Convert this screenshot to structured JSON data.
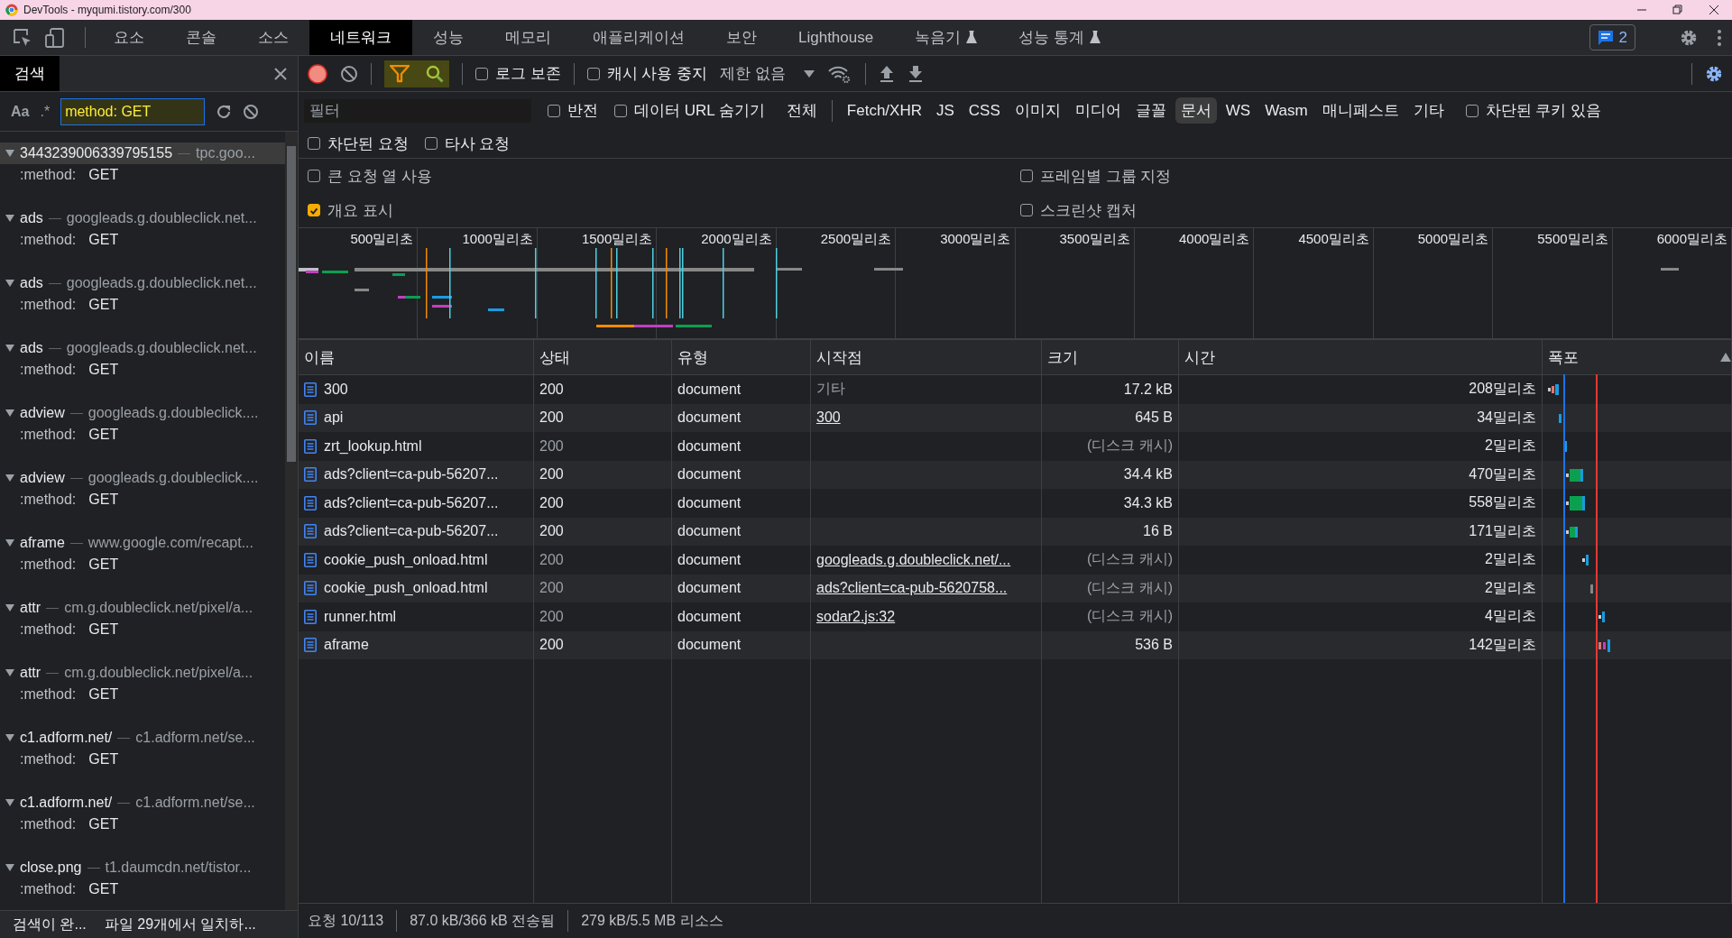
{
  "window": {
    "title": "DevTools - myqumi.tistory.com/300"
  },
  "tabs": [
    {
      "label": "요소",
      "selected": false,
      "experimental": false
    },
    {
      "label": "콘솔",
      "selected": false,
      "experimental": false
    },
    {
      "label": "소스",
      "selected": false,
      "experimental": false
    },
    {
      "label": "네트워크",
      "selected": true,
      "experimental": false
    },
    {
      "label": "성능",
      "selected": false,
      "experimental": false
    },
    {
      "label": "메모리",
      "selected": false,
      "experimental": false
    },
    {
      "label": "애플리케이션",
      "selected": false,
      "experimental": false
    },
    {
      "label": "보안",
      "selected": false,
      "experimental": false
    },
    {
      "label": "Lighthouse",
      "selected": false,
      "experimental": false
    },
    {
      "label": "녹음기",
      "selected": false,
      "experimental": true
    },
    {
      "label": "성능 통계",
      "selected": false,
      "experimental": true
    }
  ],
  "issues_badge": {
    "count": "2"
  },
  "search_panel": {
    "title": "검색",
    "case_toggle": "Aa",
    "regex_toggle": ".*",
    "query": "method: GET",
    "results": [
      {
        "name": "3443239006339795155",
        "url": "tpc.goo...",
        "selected": true,
        "expanded": true,
        "match_key": ":method:",
        "match_value": "GET"
      },
      {
        "name": "ads",
        "url": "googleads.g.doubleclick.net...",
        "selected": false,
        "expanded": true,
        "match_key": ":method:",
        "match_value": "GET"
      },
      {
        "name": "ads",
        "url": "googleads.g.doubleclick.net...",
        "selected": false,
        "expanded": true,
        "match_key": ":method:",
        "match_value": "GET"
      },
      {
        "name": "ads",
        "url": "googleads.g.doubleclick.net...",
        "selected": false,
        "expanded": true,
        "match_key": ":method:",
        "match_value": "GET"
      },
      {
        "name": "adview",
        "url": "googleads.g.doubleclick....",
        "selected": false,
        "expanded": true,
        "match_key": ":method:",
        "match_value": "GET"
      },
      {
        "name": "adview",
        "url": "googleads.g.doubleclick....",
        "selected": false,
        "expanded": true,
        "match_key": ":method:",
        "match_value": "GET"
      },
      {
        "name": "aframe",
        "url": "www.google.com/recapt...",
        "selected": false,
        "expanded": true,
        "match_key": ":method:",
        "match_value": "GET"
      },
      {
        "name": "attr",
        "url": "cm.g.doubleclick.net/pixel/a...",
        "selected": false,
        "expanded": true,
        "match_key": ":method:",
        "match_value": "GET"
      },
      {
        "name": "attr",
        "url": "cm.g.doubleclick.net/pixel/a...",
        "selected": false,
        "expanded": true,
        "match_key": ":method:",
        "match_value": "GET"
      },
      {
        "name": "c1.adform.net/",
        "url": "c1.adform.net/se...",
        "selected": false,
        "expanded": true,
        "match_key": ":method:",
        "match_value": "GET"
      },
      {
        "name": "c1.adform.net/",
        "url": "c1.adform.net/se...",
        "selected": false,
        "expanded": true,
        "match_key": ":method:",
        "match_value": "GET"
      },
      {
        "name": "close.png",
        "url": "t1.daumcdn.net/tistor...",
        "selected": false,
        "expanded": true,
        "match_key": ":method:",
        "match_value": "GET"
      }
    ],
    "status": [
      "검색이 완...",
      "파일 29개에서 일치하..."
    ]
  },
  "network": {
    "toolbar": {
      "recording": true,
      "filter_shown": true,
      "search_shown": true,
      "preserve_log": {
        "label": "로그 보존",
        "checked": false
      },
      "disable_cache": {
        "label": "캐시 사용 중지",
        "checked": false
      },
      "throttling": "제한 없음"
    },
    "filter": {
      "placeholder": "필터",
      "invert": {
        "label": "반전",
        "checked": false
      },
      "hide_data_urls": {
        "label": "데이터 URL 숨기기",
        "checked": false
      },
      "types": [
        {
          "label": "전체",
          "selected": false
        },
        {
          "label": "Fetch/XHR",
          "selected": false
        },
        {
          "label": "JS",
          "selected": false
        },
        {
          "label": "CSS",
          "selected": false
        },
        {
          "label": "이미지",
          "selected": false
        },
        {
          "label": "미디어",
          "selected": false
        },
        {
          "label": "글꼴",
          "selected": false
        },
        {
          "label": "문서",
          "selected": true
        },
        {
          "label": "WS",
          "selected": false
        },
        {
          "label": "Wasm",
          "selected": false
        },
        {
          "label": "매니페스트",
          "selected": false
        },
        {
          "label": "기타",
          "selected": false
        }
      ],
      "blocked_cookies": {
        "label": "차단된 쿠키 있음",
        "checked": false
      },
      "blocked_requests": {
        "label": "차단된 요청",
        "checked": false
      },
      "third_party": {
        "label": "타사 요청",
        "checked": false
      }
    },
    "settings": [
      {
        "label": "큰 요청 열 사용",
        "checked": false
      },
      {
        "label": "프레임별 그룹 지정",
        "checked": false
      },
      {
        "label": "개요 표시",
        "checked": true
      },
      {
        "label": "스크린샷 캡처",
        "checked": false
      }
    ],
    "overview": {
      "ticks": [
        "500밀리초",
        "1000밀리초",
        "1500밀리초",
        "2000밀리초",
        "2500밀리초",
        "3000밀리초",
        "3500밀리초",
        "4000밀리초",
        "4500밀리초",
        "5000밀리초",
        "5500밀리초",
        "6000밀리초"
      ]
    },
    "table": {
      "columns": [
        "이름",
        "상태",
        "유형",
        "시작점",
        "크기",
        "시간",
        "폭포"
      ],
      "rows": [
        {
          "name": "300",
          "status": "200",
          "cached": false,
          "type": "document",
          "initiator": "기타",
          "initiator_link": false,
          "size": "17.2 kB",
          "time": "208밀리초"
        },
        {
          "name": "api",
          "status": "200",
          "cached": false,
          "type": "document",
          "initiator": "300",
          "initiator_link": true,
          "size": "645 B",
          "time": "34밀리초"
        },
        {
          "name": "zrt_lookup.html",
          "status": "200",
          "cached": true,
          "type": "document",
          "size": "(디스크 캐시)",
          "time": "2밀리초"
        },
        {
          "name": "ads?client=ca-pub-56207...",
          "status": "200",
          "cached": false,
          "type": "document",
          "size": "34.4 kB",
          "time": "470밀리초"
        },
        {
          "name": "ads?client=ca-pub-56207...",
          "status": "200",
          "cached": false,
          "type": "document",
          "size": "34.3 kB",
          "time": "558밀리초"
        },
        {
          "name": "ads?client=ca-pub-56207...",
          "status": "200",
          "cached": false,
          "type": "document",
          "size": "16 B",
          "time": "171밀리초"
        },
        {
          "name": "cookie_push_onload.html",
          "status": "200",
          "cached": true,
          "type": "document",
          "initiator": "googleads.g.doubleclick.net/...",
          "initiator_link": true,
          "size": "(디스크 캐시)",
          "time": "2밀리초"
        },
        {
          "name": "cookie_push_onload.html",
          "status": "200",
          "cached": true,
          "type": "document",
          "initiator": "ads?client=ca-pub-5620758...",
          "initiator_link": true,
          "size": "(디스크 캐시)",
          "time": "2밀리초"
        },
        {
          "name": "runner.html",
          "status": "200",
          "cached": true,
          "type": "document",
          "initiator": "sodar2.js:32",
          "initiator_link": true,
          "size": "(디스크 캐시)",
          "time": "4밀리초"
        },
        {
          "name": "aframe",
          "status": "200",
          "cached": false,
          "type": "document",
          "size": "536 B",
          "time": "142밀리초"
        }
      ]
    },
    "status_bar": [
      "요청 10/113",
      "87.0 kB/366 kB 전송됨",
      "279 kB/5.5 MB 리소스"
    ]
  }
}
